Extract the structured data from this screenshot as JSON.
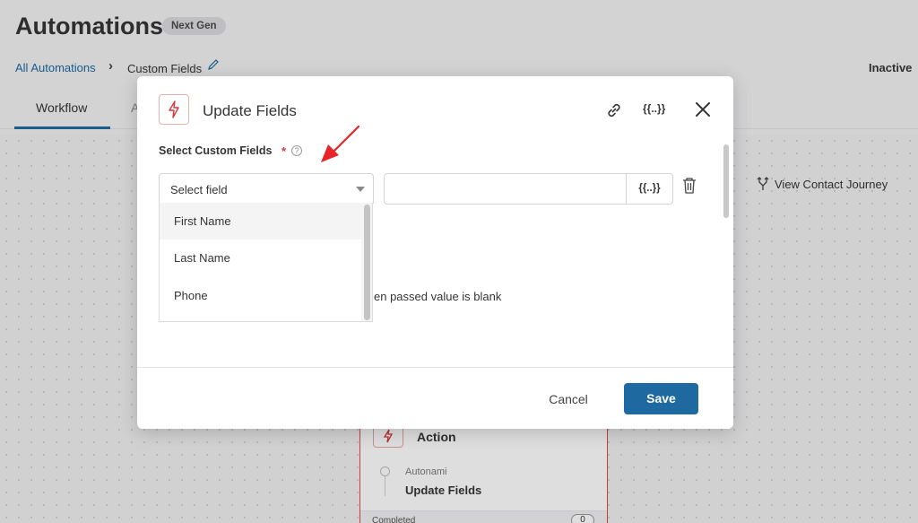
{
  "page": {
    "title": "Automations",
    "badge": "Next Gen",
    "breadcrumb": {
      "root": "All Automations",
      "current": "Custom Fields"
    },
    "status": "Inactive",
    "tabs": [
      {
        "label": "Workflow"
      },
      {
        "label": "A"
      }
    ],
    "journey_link": "View Contact Journey",
    "node": {
      "title": "Action",
      "provider": "Autonami",
      "action": "Update Fields",
      "footer_label": "Completed",
      "footer_count": "0"
    }
  },
  "modal": {
    "title": "Update Fields",
    "merge_tag_label": "{{..}}",
    "field_label": "Select Custom Fields",
    "required_mark": "*",
    "help_glyph": "?",
    "select_placeholder": "Select field",
    "value_input": "",
    "merge_button": "{{..}}",
    "dropdown_options": [
      "First Name",
      "Last Name",
      "Phone"
    ],
    "hint_text": "en passed value is blank",
    "cancel_label": "Cancel",
    "save_label": "Save"
  },
  "colors": {
    "accent": "#1e6aa0",
    "danger": "#d4373c",
    "annotation_arrow": "#e8232a"
  },
  "icons": {
    "header": "bolt-icon",
    "link": "link-icon",
    "close": "close-icon",
    "trash": "trash-icon",
    "edit": "pencil-icon",
    "journey": "branch-icon"
  }
}
